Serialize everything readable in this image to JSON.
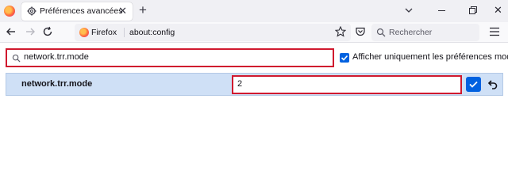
{
  "tab": {
    "title": "Préférences avancées"
  },
  "urlbar": {
    "identity": "Firefox",
    "url": "about:config"
  },
  "searchbar": {
    "placeholder": "Rechercher"
  },
  "config": {
    "search_value": "network.trr.mode",
    "show_modified_label": "Afficher uniquement les préférences modifiées",
    "show_modified_checked": true,
    "preference": {
      "name": "network.trr.mode",
      "edit_value": "2"
    }
  },
  "colors": {
    "accent": "#0061e0",
    "highlight_border": "#d0192e",
    "row_selected": "#cfe0f6"
  }
}
